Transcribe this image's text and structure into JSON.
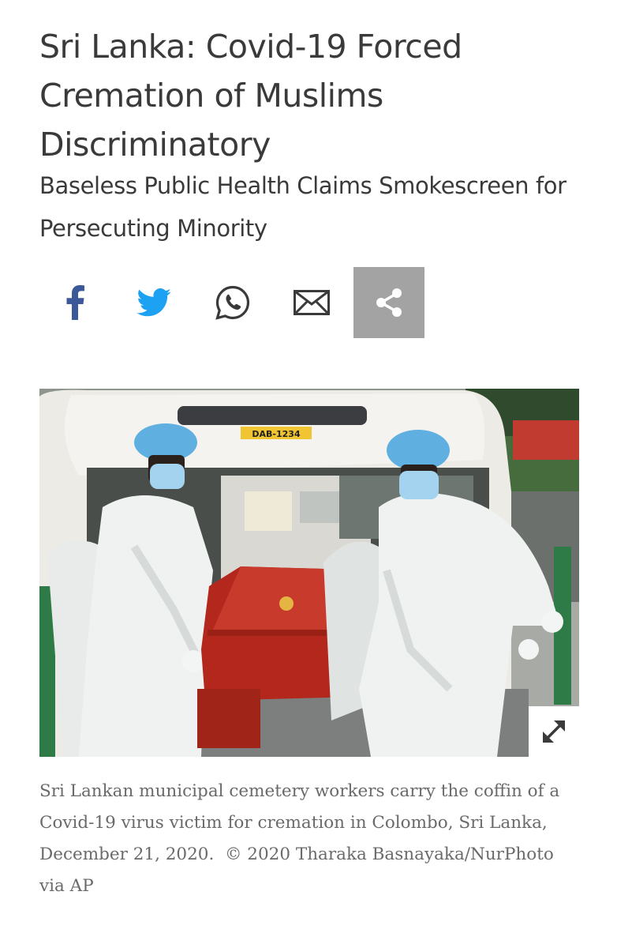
{
  "article": {
    "title": "Sri Lanka: Covid-19 Forced Cremation of Muslims Discriminatory",
    "subtitle": "Baseless Public Health Claims Smokescreen for Persecuting Minority"
  },
  "share": {
    "buttons": [
      {
        "icon": "facebook-icon",
        "color": "#3b5998"
      },
      {
        "icon": "twitter-icon",
        "color": "#1da1f2"
      },
      {
        "icon": "whatsapp-icon",
        "color": "#3a3a3a"
      },
      {
        "icon": "email-icon",
        "color": "#3a3a3a"
      },
      {
        "icon": "share-icon",
        "color": "#ffffff",
        "background": "#a3a3a3"
      }
    ]
  },
  "photo": {
    "plate_text": "DAB-1234",
    "caption_main": "Sri Lankan municipal cemetery workers carry the coffin of a Covid-19 virus victim for cremation in Colombo, Sri Lanka, December 21, 2020.",
    "credit": "© 2020 Tharaka Basnayaka/NurPhoto via AP",
    "expand_icon": "expand-icon"
  }
}
